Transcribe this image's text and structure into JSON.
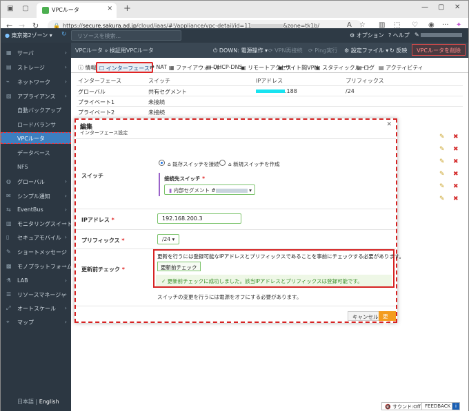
{
  "browser": {
    "tab_title": "VPCルータ",
    "url_prefix": "https://",
    "url_host": "secure.sakura.ad.jp",
    "url_path": "/cloud/iaas/#!/appliance/vpc-detail/id=11",
    "url_suffix": "&zone=tk1b/"
  },
  "topnav": {
    "zone": "東京第2ゾーン",
    "search_placeholder": "リソースを検索...",
    "options": "オプション",
    "help": "ヘルプ"
  },
  "sidebar": {
    "items": [
      {
        "label": "サーバ",
        "icon": "server-icon"
      },
      {
        "label": "ストレージ",
        "icon": "storage-icon"
      },
      {
        "label": "ネットワーク",
        "icon": "network-icon"
      },
      {
        "label": "アプライアンス",
        "icon": "appliance-icon"
      },
      {
        "label": "自動バックアップ",
        "sub": true
      },
      {
        "label": "ロードバランサ",
        "sub": true
      },
      {
        "label": "VPCルータ",
        "sub": true,
        "active": true
      },
      {
        "label": "データベース",
        "sub": true
      },
      {
        "label": "NFS",
        "sub": true
      },
      {
        "label": "グローバル",
        "icon": "globe-icon"
      },
      {
        "label": "シンプル通知",
        "icon": "notify-icon"
      },
      {
        "label": "EventBus",
        "icon": "eventbus-icon"
      },
      {
        "label": "モニタリングスイート",
        "icon": "monitor-icon"
      },
      {
        "label": "セキュアモバイル",
        "icon": "mobile-icon"
      },
      {
        "label": "ショートメッセージ",
        "icon": "message-icon"
      },
      {
        "label": "モノプラットフォーム",
        "icon": "platform-icon"
      },
      {
        "label": "LAB",
        "icon": "lab-icon"
      },
      {
        "label": "リソースマネージャ",
        "icon": "resource-icon"
      },
      {
        "label": "オートスケール",
        "icon": "autoscale-icon"
      },
      {
        "label": "マップ",
        "icon": "map-icon"
      }
    ],
    "lang_ja": "日本語",
    "lang_en": "English"
  },
  "breadcrumb": {
    "root": "VPCルータ",
    "sep": "»",
    "current": "検証用VPCルータ"
  },
  "actions": {
    "power": "DOWN: 電源操作",
    "vpn": "VPN再接続",
    "ping": "Ping実行",
    "config": "設定ファイル",
    "refresh": "反映",
    "delete": "VPCルータを削除"
  },
  "detail_tabs": [
    "情報",
    "インターフェース",
    "NAT",
    "ファイアウォール",
    "DHCP-DNS",
    "リモートアクセス",
    "サイト間VPN",
    "スタティックルート",
    "ログ",
    "アクティビティ"
  ],
  "table": {
    "headers": [
      "インターフェース",
      "スイッチ",
      "IPアドレス",
      "プリフィックス"
    ],
    "rows": [
      {
        "name": "グローバル",
        "switch": "共有セグメント",
        "ip": ".188",
        "prefix": "/24"
      },
      {
        "name": "プライベート1",
        "switch": "未接続",
        "ip": "",
        "prefix": ""
      },
      {
        "name": "プライベート2",
        "switch": "未接続",
        "ip": "",
        "prefix": ""
      }
    ]
  },
  "modal": {
    "title": "編集",
    "subtitle": "インターフェース設定",
    "switch_label": "スイッチ",
    "opt_existing": "既存スイッチを接続",
    "opt_new": "新規スイッチを作成",
    "target_label": "接続先スイッチ",
    "target_value": "内部セグメント #",
    "ip_label": "IPアドレス",
    "ip_value": "192.168.200.3",
    "prefix_label": "プリフィックス",
    "prefix_value": "/24",
    "check_label": "更新前チェック",
    "check_msg": "更新を行うには登録可能なIPアドレスとプリフィックスであることを事前にチェックする必要があります。",
    "check_button": "更新前チェック",
    "check_ok": "更新前チェックに成功しました。該当IPアドレスとプリフィックスは登録可能です。",
    "note": "スイッチの変更を行うには電源をオフにする必要があります。",
    "cancel": "キャンセル",
    "save": "更新"
  },
  "footer": {
    "sound": "サウンド:Off",
    "feedback": "FEEDBACK"
  }
}
